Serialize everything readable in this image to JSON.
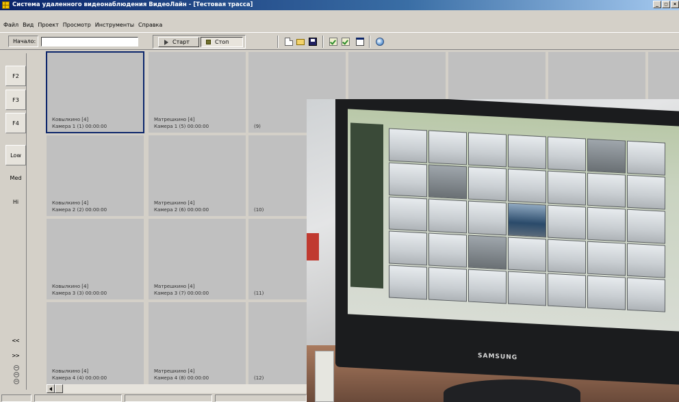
{
  "window": {
    "title": "Система удаленного видеонаблюдения ВидеоЛайн - [Тестовая трасса]",
    "buttons": [
      "_",
      "□",
      "×"
    ]
  },
  "menu": [
    "Файл",
    "Вид",
    "Проект",
    "Просмотр",
    "Инструменты",
    "Справка"
  ],
  "toolbar": {
    "start_label": "Начало:",
    "start_value": "",
    "start_button": "Старт",
    "stop_button": "Стоп",
    "icons": [
      "new-file-icon",
      "open-folder-icon",
      "save-icon",
      "check-icon",
      "check-icon",
      "window-icon",
      "database-icon"
    ]
  },
  "left_panel": {
    "f_keys": [
      "F2",
      "F3",
      "F4"
    ],
    "quality": [
      "Low",
      "Med",
      "Hi"
    ],
    "nav_prev": "<<",
    "nav_next": ">>"
  },
  "grid": {
    "columns": [
      {
        "cells": [
          {
            "line1": "Ковылкино [4]",
            "line2": "Камера 1 (1)  00:00:00",
            "selected": true
          },
          {
            "line1": "Ковылкино [4]",
            "line2": "Камера 2 (2)  00:00:00"
          },
          {
            "line1": "Ковылкино [4]",
            "line2": "Камера 3 (3)  00:00:00"
          },
          {
            "line1": "Ковылкино [4]",
            "line2": "Камера 4 (4)  00:00:00"
          }
        ]
      },
      {
        "cells": [
          {
            "line1": "Матрешкино [4]",
            "line2": "Камера 1 (5)  00:00:00"
          },
          {
            "line1": "Матрешкино [4]",
            "line2": "Камера 2 (6)  00:00:00"
          },
          {
            "line1": "Матрешкино [4]",
            "line2": "Камера 3 (7)  00:00:00"
          },
          {
            "line1": "Матрешкино [4]",
            "line2": "Камера 4 (8)  00:00:00"
          }
        ]
      },
      {
        "cells": [
          {
            "line1": "",
            "line2": "(9)"
          },
          {
            "line1": "",
            "line2": "(10)"
          },
          {
            "line1": "",
            "line2": "(11)"
          },
          {
            "line1": "",
            "line2": "(12)"
          }
        ]
      }
    ],
    "extra_top_cells": 4
  },
  "photo": {
    "brand": "SAMSUNG"
  }
}
